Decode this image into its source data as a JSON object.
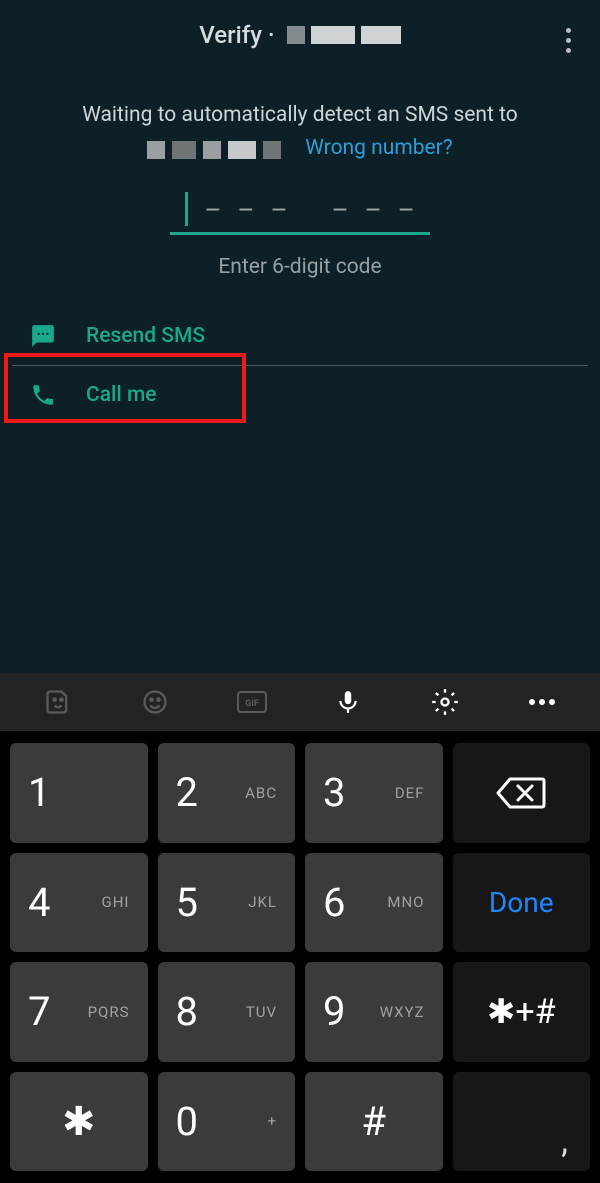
{
  "header": {
    "title": "Verify ·"
  },
  "intro": {
    "line": "Waiting to automatically detect an SMS sent to",
    "wrong": "Wrong number?"
  },
  "code": {
    "hint": "Enter 6-digit code"
  },
  "actions": {
    "resend": "Resend SMS",
    "call": "Call me"
  },
  "keypad": {
    "k1": {
      "n": "1",
      "l": ""
    },
    "k2": {
      "n": "2",
      "l": "ABC"
    },
    "k3": {
      "n": "3",
      "l": "DEF"
    },
    "k4": {
      "n": "4",
      "l": "GHI"
    },
    "k5": {
      "n": "5",
      "l": "JKL"
    },
    "k6": {
      "n": "6",
      "l": "MNO"
    },
    "k7": {
      "n": "7",
      "l": "PQRS"
    },
    "k8": {
      "n": "8",
      "l": "TUV"
    },
    "k9": {
      "n": "9",
      "l": "WXYZ"
    },
    "k0": {
      "n": "0",
      "l": "+"
    },
    "star": "✱",
    "hash": "#",
    "symkey": "✱+#",
    "done": "Done",
    "comma": ","
  }
}
